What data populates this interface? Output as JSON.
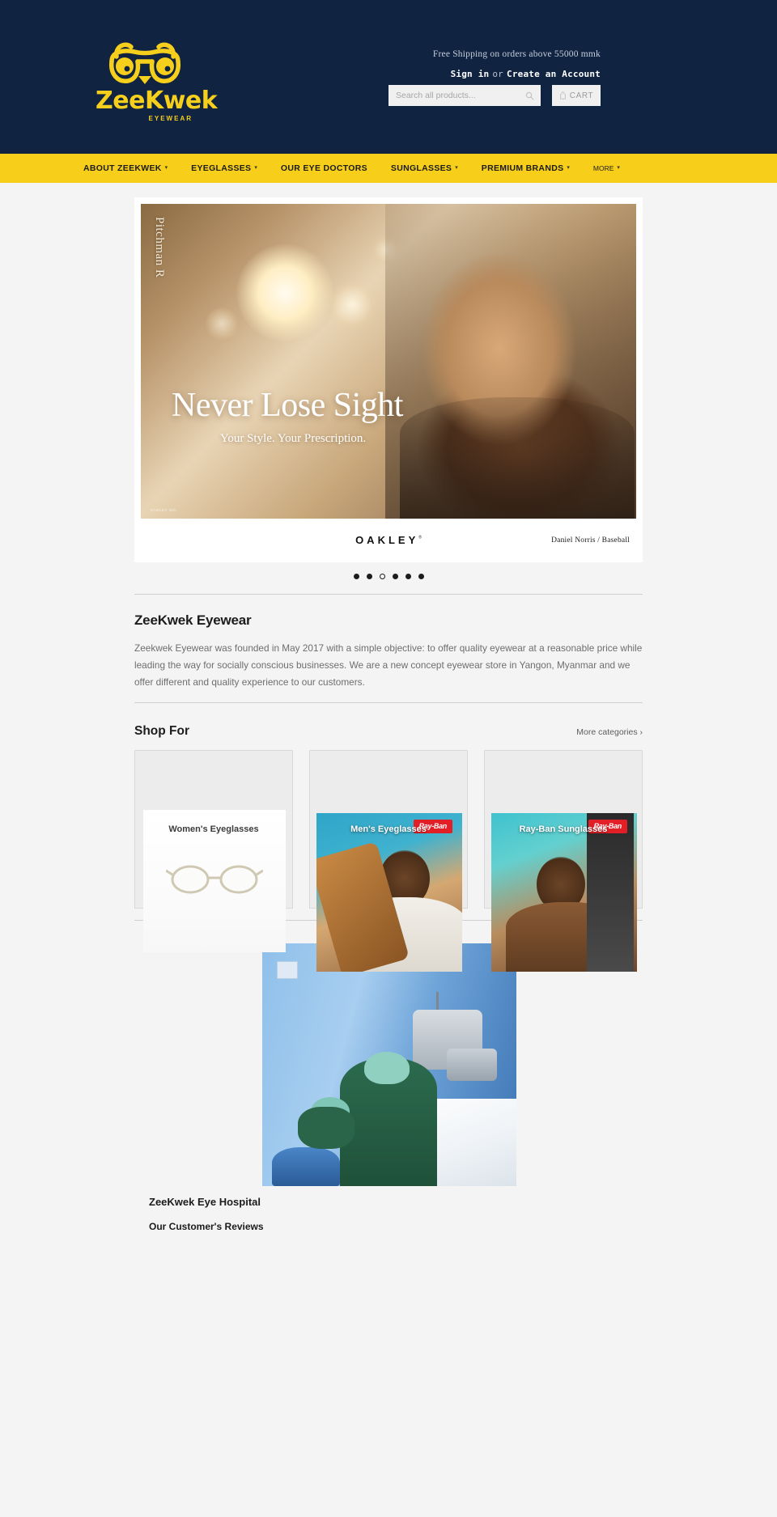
{
  "brand": {
    "name": "ZeeKwek",
    "tagline": "EYEWEAR",
    "logo_icon": "owl-glasses-icon",
    "yellow": "#f7cf1b",
    "navy": "#102341"
  },
  "header": {
    "shipping_note": "Free Shipping on orders above 55000 mmk",
    "sign_in_label": "Sign in",
    "or_label": "or",
    "create_account_label": "Create an Account",
    "search_placeholder": "Search all products...",
    "search_value": "",
    "search_icon": "search-icon",
    "cart_label": "CART",
    "cart_icon": "shopping-bag-icon"
  },
  "nav": {
    "items": [
      {
        "label": "ABOUT ZEEKWEK",
        "has_dropdown": true
      },
      {
        "label": "EYEGLASSES",
        "has_dropdown": true
      },
      {
        "label": "OUR EYE DOCTORS",
        "has_dropdown": false
      },
      {
        "label": "SUNGLASSES",
        "has_dropdown": true
      },
      {
        "label": "PREMIUM BRANDS",
        "has_dropdown": true
      },
      {
        "label": "MORE",
        "has_dropdown": true
      }
    ],
    "caret_glyph": "▾"
  },
  "hero": {
    "vertical_text": "Pitchman R",
    "title": "Never Lose Sight",
    "subtitle": "Your Style. Your Prescription.",
    "tiny_credit": "OAKLEY INC.",
    "logo_text": "OAKLEY",
    "logo_tm": "®",
    "credit": "Daniel Norris / Baseball",
    "slides_total": 6,
    "active_slide": 3
  },
  "about": {
    "heading": "ZeeKwek Eyewear",
    "body": "Zeekwek Eyewear was founded in May 2017 with a simple objective: to offer quality eyewear at a reasonable price while leading the way for socially conscious businesses. We are a new concept eyewear store in Yangon, Myanmar and we offer different and quality experience to our customers."
  },
  "shop": {
    "heading": "Shop For",
    "more_link": "More categories  ›",
    "cards": [
      {
        "label": "Women's Eyeglasses",
        "style": "dark",
        "badge": null
      },
      {
        "label": "Men's Eyeglasses",
        "style": "light",
        "badge": "Ray-Ban"
      },
      {
        "label": "Ray-Ban Sunglasses",
        "style": "light",
        "badge": "Ray-Ban"
      }
    ]
  },
  "hospital": {
    "title": "ZeeKwek Eye Hospital",
    "reviews_title": "Our Customer's Reviews"
  }
}
